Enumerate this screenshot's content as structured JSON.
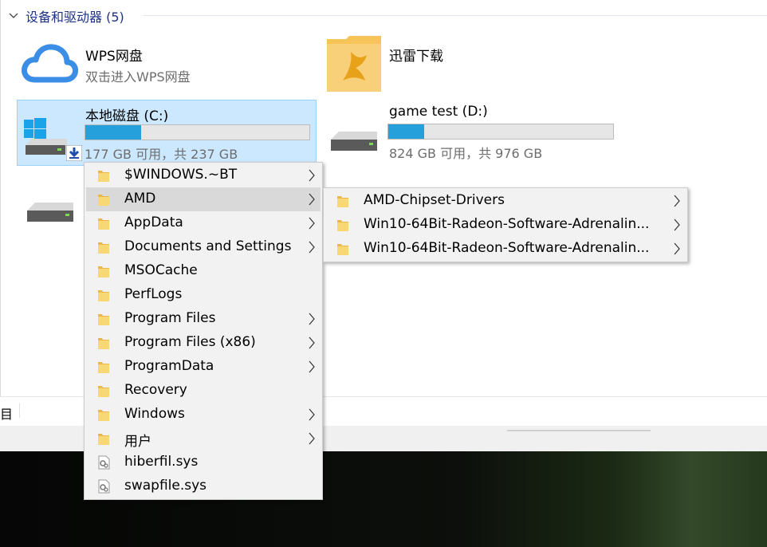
{
  "group": {
    "title": "设备和驱动器 (5)"
  },
  "tiles": {
    "wps": {
      "name": "WPS网盘",
      "sub": "双击进入WPS网盘"
    },
    "xunlei": {
      "name": "迅雷下载"
    },
    "c_drive": {
      "name": "本地磁盘 (C:)",
      "space": "177 GB 可用，共 237 GB",
      "used_fraction": 0.25
    },
    "d_drive": {
      "name": "game test (D:)",
      "space": "824 GB 可用，共 976 GB",
      "used_fraction": 0.16
    }
  },
  "status": {
    "text": "目"
  },
  "menu": {
    "items": [
      {
        "label": "$WINDOWS.~BT",
        "icon": "folder-icon",
        "submenu": true
      },
      {
        "label": "AMD",
        "icon": "folder-icon",
        "submenu": true,
        "highlighted": true
      },
      {
        "label": "AppData",
        "icon": "folder-icon",
        "submenu": true
      },
      {
        "label": "Documents and Settings",
        "icon": "folder-icon",
        "submenu": true
      },
      {
        "label": "MSOCache",
        "icon": "folder-icon",
        "submenu": false
      },
      {
        "label": "PerfLogs",
        "icon": "folder-icon",
        "submenu": false
      },
      {
        "label": "Program Files",
        "icon": "folder-icon",
        "submenu": true
      },
      {
        "label": "Program Files (x86)",
        "icon": "folder-icon",
        "submenu": true
      },
      {
        "label": "ProgramData",
        "icon": "folder-icon",
        "submenu": true
      },
      {
        "label": "Recovery",
        "icon": "folder-icon",
        "submenu": false
      },
      {
        "label": "Windows",
        "icon": "folder-icon",
        "submenu": true
      },
      {
        "label": "用户",
        "icon": "folder-icon",
        "submenu": true
      },
      {
        "label": "hiberfil.sys",
        "icon": "system-file-icon",
        "submenu": false
      },
      {
        "label": "swapfile.sys",
        "icon": "system-file-icon",
        "submenu": false
      }
    ]
  },
  "submenu": {
    "items": [
      {
        "label": "AMD-Chipset-Drivers",
        "icon": "folder-icon",
        "submenu": true
      },
      {
        "label": "Win10-64Bit-Radeon-Software-Adrenalin...",
        "icon": "folder-icon",
        "submenu": true
      },
      {
        "label": "Win10-64Bit-Radeon-Software-Adrenalin...",
        "icon": "folder-icon",
        "submenu": true
      }
    ]
  },
  "colors": {
    "accent": "#26a0da",
    "selection": "#cce8ff",
    "menu_bg": "#f2f2f2",
    "menu_highlight": "#d9d9d9",
    "folder": "#f8d775"
  }
}
